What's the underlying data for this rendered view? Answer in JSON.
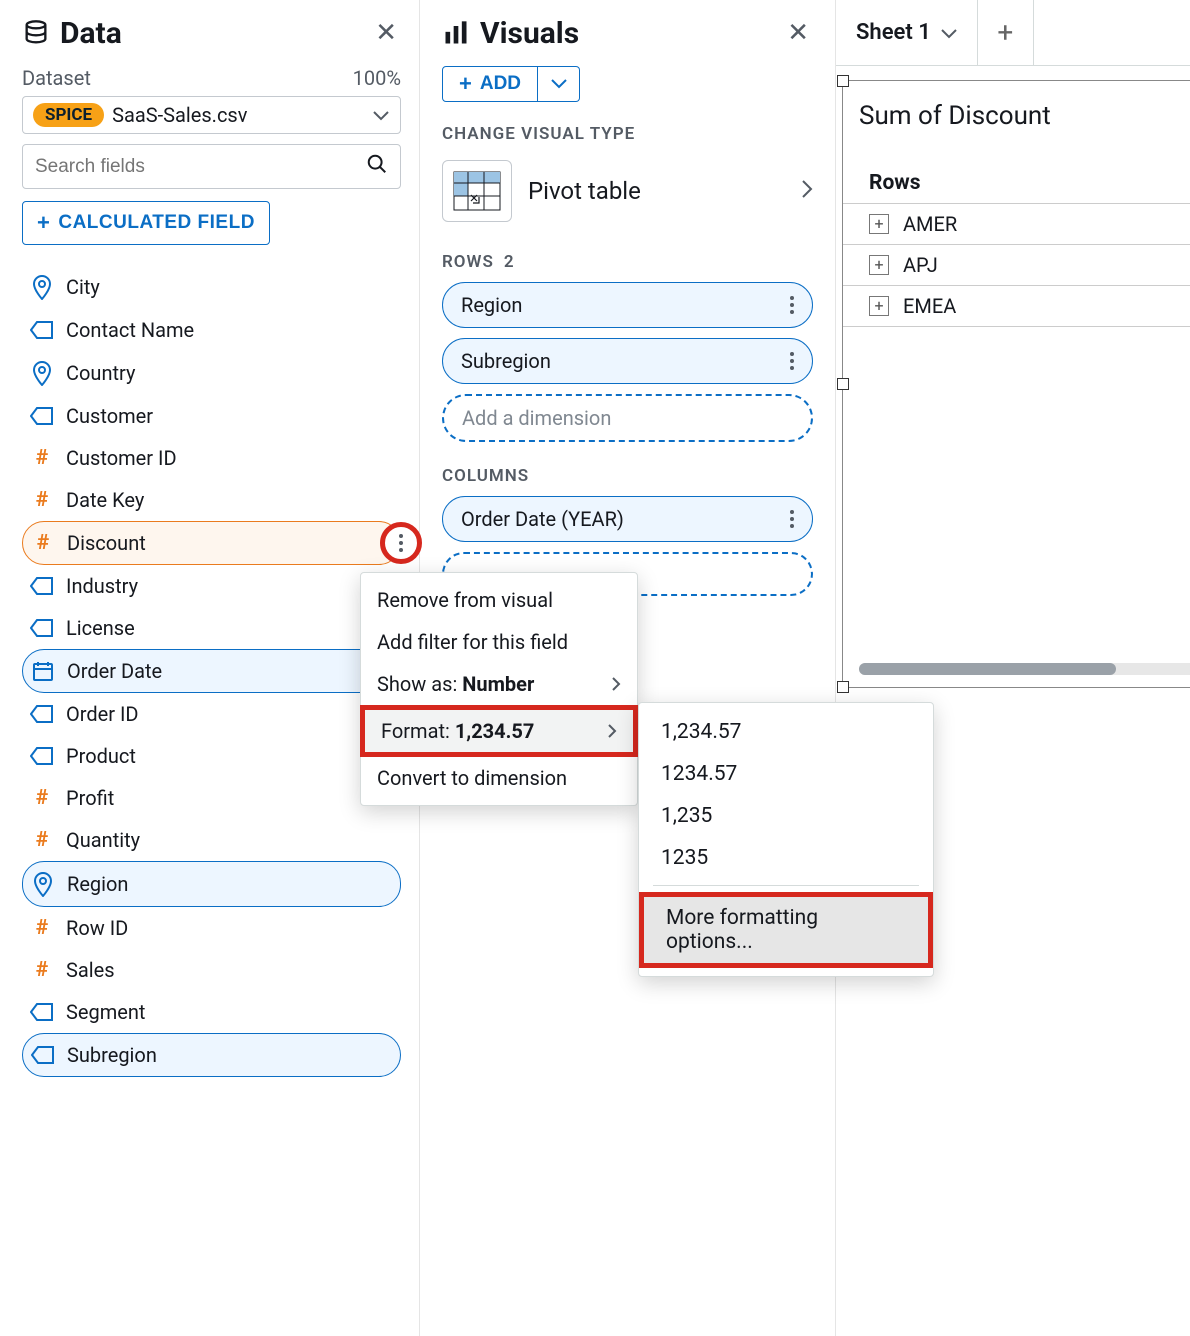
{
  "data_panel": {
    "title": "Data",
    "dataset_label": "Dataset",
    "zoom": "100%",
    "spice_badge": "SPICE",
    "dataset_name": "SaaS-Sales.csv",
    "search_placeholder": "Search fields",
    "calc_button": "CALCULATED FIELD",
    "fields": [
      {
        "name": "City",
        "type": "geo"
      },
      {
        "name": "Contact Name",
        "type": "dim"
      },
      {
        "name": "Country",
        "type": "geo"
      },
      {
        "name": "Customer",
        "type": "dim"
      },
      {
        "name": "Customer ID",
        "type": "num"
      },
      {
        "name": "Date Key",
        "type": "num"
      },
      {
        "name": "Discount",
        "type": "num",
        "pill": "orange",
        "ellipsis": true
      },
      {
        "name": "Industry",
        "type": "dim"
      },
      {
        "name": "License",
        "type": "dim"
      },
      {
        "name": "Order Date",
        "type": "date",
        "pill": "blue"
      },
      {
        "name": "Order ID",
        "type": "dim"
      },
      {
        "name": "Product",
        "type": "dim"
      },
      {
        "name": "Profit",
        "type": "num"
      },
      {
        "name": "Quantity",
        "type": "num"
      },
      {
        "name": "Region",
        "type": "geo",
        "pill": "blue"
      },
      {
        "name": "Row ID",
        "type": "num"
      },
      {
        "name": "Sales",
        "type": "num"
      },
      {
        "name": "Segment",
        "type": "dim"
      },
      {
        "name": "Subregion",
        "type": "dim",
        "pill": "blue"
      }
    ]
  },
  "visuals_panel": {
    "title": "Visuals",
    "add_button": "ADD",
    "change_label": "CHANGE VISUAL TYPE",
    "visual_type": "Pivot table",
    "rows_label": "ROWS",
    "rows_count": "2",
    "rows": [
      "Region",
      "Subregion"
    ],
    "rows_placeholder": "Add a dimension",
    "columns_label": "COLUMNS",
    "columns": [
      "Order Date (YEAR)"
    ]
  },
  "context_menu": {
    "remove": "Remove from visual",
    "add_filter": "Add filter for this field",
    "show_as_label": "Show as: ",
    "show_as_value": "Number",
    "format_label": "Format: ",
    "format_value": "1,234.57",
    "convert": "Convert to dimension"
  },
  "format_submenu": {
    "opt1": "1,234.57",
    "opt2": "1234.57",
    "opt3": "1,235",
    "opt4": "1235",
    "more": "More formatting options..."
  },
  "sheet": {
    "tab": "Sheet 1",
    "viz_title": "Sum of Discount",
    "rows_header": "Rows",
    "rows": [
      "AMER",
      "APJ",
      "EMEA"
    ]
  }
}
